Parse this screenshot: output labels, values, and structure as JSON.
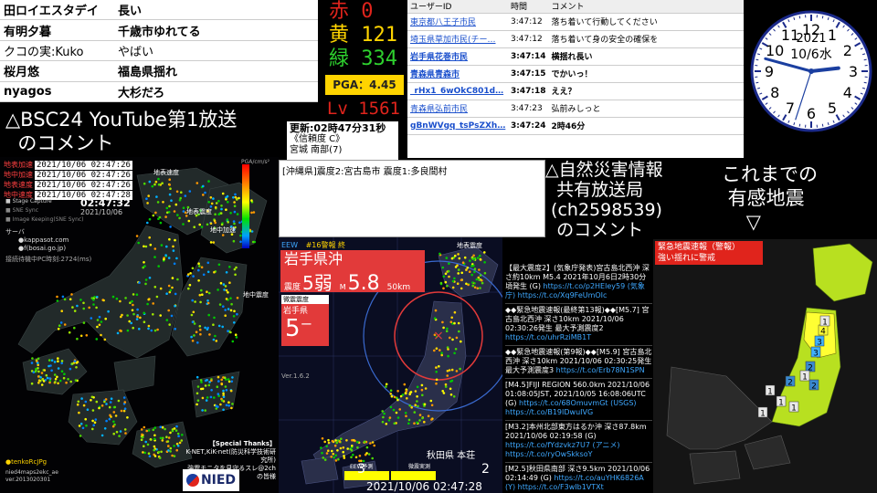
{
  "top_comments": [
    {
      "name": "田ロイエスタデイ",
      "msg": "長い"
    },
    {
      "name": "有明夕暮",
      "msg": "千歳市ゆれてる"
    },
    {
      "name": "クコの実:Kuko",
      "msg": "やばい"
    },
    {
      "name": "桜月悠",
      "msg": "福島県揺れ"
    },
    {
      "name": "nyagos",
      "msg": "大杉だろ"
    }
  ],
  "label_bsc": "△BSC24 YouTube第1放送\n  のコメント",
  "label_disaster": "△自然災害情報\n  共有放送局\n (ch2598539)\n  のコメント",
  "label_past": "これまでの\n 有感地震\n    ▽",
  "counters": {
    "red_label": "赤",
    "red_value": "0",
    "yellow_label": "黄",
    "yellow_value": "121",
    "green_label": "緑",
    "green_value": "334"
  },
  "pga": "PGA：4.45",
  "lv": "Lv 1561",
  "update": {
    "time": "更新:02時47分31秒",
    "line1": "《信頼度 C》",
    "line2": "宮城 南部(7)"
  },
  "user_table": {
    "headers": [
      "ユーザーID",
      "時間",
      "コメント"
    ],
    "rows": [
      {
        "uid": "東京都八王子市民",
        "time": "3:47:12",
        "comment": "落ち着いて行動してください",
        "bold": false
      },
      {
        "uid": "埼玉県草加市民(チー…",
        "time": "3:47:12",
        "comment": "落ち着いて身の安全の確保を",
        "bold": false
      },
      {
        "uid": "岩手県花巻市民",
        "time": "3:47:14",
        "comment": "横揺れ長い",
        "bold": true
      },
      {
        "uid": "青森県青森市",
        "time": "3:47:15",
        "comment": "でかいっ！",
        "bold": true
      },
      {
        "uid": "_rHx1_6wOkC801d…",
        "time": "3:47:18",
        "comment": "ええ？",
        "bold": true
      },
      {
        "uid": "青森県弘前市民",
        "time": "3:47:23",
        "comment": "弘前みしっと",
        "bold": false
      },
      {
        "uid": "gBnWVgq_tsPsZXh…",
        "time": "3:47:24",
        "comment": "2時46分",
        "bold": true
      }
    ]
  },
  "quake_text": "[沖縄県]震度2:宮古島市  震度1:多良間村",
  "left_map": {
    "rows": [
      {
        "label": "地表加速",
        "value": "2021/10/06 02:47:26"
      },
      {
        "label": "地中加速",
        "value": "2021/10/06 02:47:26"
      },
      {
        "label": "地表速度",
        "value": "2021/10/06 02:47:26"
      },
      {
        "label": "地中速度",
        "value": "2021/10/06 02:47:28"
      }
    ],
    "time": "02:47:32",
    "date": "2021/10/06",
    "legend": [
      "Stage Capture",
      "SNE Sync",
      "Image Keeping(SNE Sync)"
    ],
    "server_label": "サーバ",
    "servers": [
      "●kappasot.com",
      "●f(bosai.go.jp)"
    ],
    "status": "接続待機中PC時刻:2724(ms)",
    "regions": [
      "地表速度",
      "地表震度",
      "地中加速",
      "地中震度"
    ],
    "thanks_title": "【Special Thanks】",
    "thanks_1": "K-NET,KiK-net(防災科学技術研究所)",
    "thanks_2": "強震モニタを見守るスレ@2ch の皆様",
    "author": "●tenkoRcJPg",
    "version_1": "nied4maps2ekc_ae",
    "version_2": "ver.2013020301",
    "logo": "NIED",
    "scale_top": "PGA/cm/s²"
  },
  "center_map": {
    "eew": "EEW",
    "report": "#16警報 終",
    "region": "岩手県沖",
    "intensity_label": "震度",
    "intensity": "5弱",
    "mag_label": "M",
    "mag": "5.8",
    "depth": "50km",
    "obs_label_1": "微震震度",
    "obs_label_2": "岩手県",
    "obs_value": "5⁻",
    "map_label": "地表震度",
    "version": "Ver.1.6.2",
    "location": "秋田県 本荘",
    "count_left": "3",
    "count_right": "2",
    "eew_forecast": "EEW予測",
    "obs_actual": "微震実測",
    "datetime": "2021/10/06  02:47:28"
  },
  "disaster_entries": [
    {
      "text": "【最大震度2】(気象庁発表)宮古島北西沖 深さ約10km M5.4 2021年10月6日2時30分頃発生 (G)",
      "link": "https://t.co/p2HEley59 (気象庁) https://t.co/Xq9FeUmOIc"
    },
    {
      "text": "◆◆緊急地震速報(最終第13報)◆◆[M5.7] 宮古島北西沖 深さ10km 2021/10/06 02:30:26発生 最大予測震度2",
      "link": "https://t.co/uhrRziMB1T"
    },
    {
      "text": "◆◆緊急地震速報(第9報)◆◆[M5.9] 宮古島北西沖 深さ10km 2021/10/06 02:30:25発生 最大予測震度3",
      "link": "https://t.co/Erb78N1SPN"
    },
    {
      "text": "[M4.5]FIJI REGION 560.0km 2021/10/06 01:08:05JST, 2021/10/05 16:08:06UTC (G)",
      "link": "https://t.co/68OmuvmGt (USGS) https://t.co/B19IDwuIVG"
    },
    {
      "text": "[M3.2]本州北部東方はるか沖 深さ87.8km 2021/10/06 02:19:58 (G)",
      "link": "https://t.co/fYdzvkz7U7 (アニメ) https://t.co/ryOwSkksoY"
    },
    {
      "text": "[M2.5]秋田県南部 深さ9.5km 2021/10/06 02:14:49 (G)",
      "link": "https://t.co/auYHK6826A (Y) https://t.co/F3wIb1VTXt"
    }
  ],
  "right_map": {
    "title": "緊急地震速報（警報）",
    "subtitle": "強い揺れに警戒",
    "intensities": [
      "4",
      "3",
      "3",
      "2",
      "2",
      "1",
      "1",
      "1",
      "1",
      "1",
      "2",
      "1"
    ]
  },
  "clock": {
    "year": "2021",
    "date": "10/6水",
    "numbers": [
      "12",
      "1",
      "2",
      "3",
      "4",
      "5",
      "6",
      "7",
      "8",
      "9",
      "10",
      "11"
    ],
    "hour": 2,
    "minute": 47,
    "second": 33
  },
  "colors": {
    "red": "#e0241c",
    "yellow": "#ffd400",
    "green": "#2ed02e",
    "link": "#1a4fcc",
    "eew_red": "#e23a3a"
  }
}
